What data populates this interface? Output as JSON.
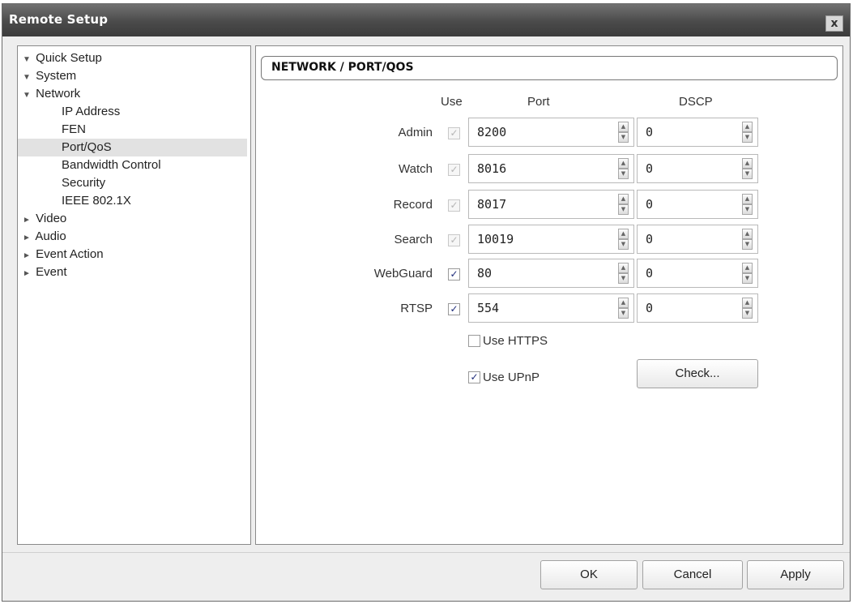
{
  "window": {
    "title": "Remote Setup",
    "close_label": "x"
  },
  "tree": {
    "items": [
      {
        "label": "Quick Setup",
        "expanded": true
      },
      {
        "label": "System",
        "expanded": true
      },
      {
        "label": "Network",
        "expanded": true
      },
      {
        "label": "IP Address"
      },
      {
        "label": "FEN"
      },
      {
        "label": "Port/QoS",
        "selected": true
      },
      {
        "label": "Bandwidth Control"
      },
      {
        "label": "Security"
      },
      {
        "label": "IEEE 802.1X"
      },
      {
        "label": "Video",
        "expanded": false
      },
      {
        "label": "Audio",
        "expanded": false
      },
      {
        "label": "Event Action",
        "expanded": false
      },
      {
        "label": "Event",
        "expanded": false
      }
    ],
    "arrow_expanded": "▼",
    "arrow_collapsed": "►"
  },
  "section": {
    "title": "NETWORK / PORT/QOS",
    "col_use": "Use",
    "col_port": "Port",
    "col_dscp": "DSCP",
    "rows": [
      {
        "label": "Admin",
        "use": true,
        "use_enabled": false,
        "port": "8200",
        "dscp": "0"
      },
      {
        "label": "Watch",
        "use": true,
        "use_enabled": false,
        "port": "8016",
        "dscp": "0"
      },
      {
        "label": "Record",
        "use": true,
        "use_enabled": false,
        "port": "8017",
        "dscp": "0"
      },
      {
        "label": "Search",
        "use": true,
        "use_enabled": false,
        "port": "10019",
        "dscp": "0"
      },
      {
        "label": "WebGuard",
        "use": true,
        "use_enabled": true,
        "port": "80",
        "dscp": "0"
      },
      {
        "label": "RTSP",
        "use": true,
        "use_enabled": true,
        "port": "554",
        "dscp": "0"
      }
    ]
  },
  "options": {
    "https_label": "Use HTTPS",
    "https_checked": false,
    "upnp_label": "Use UPnP",
    "upnp_checked": true,
    "check_button": "Check..."
  },
  "footer": {
    "ok": "OK",
    "cancel": "Cancel",
    "apply": "Apply"
  },
  "check_glyph": "✓"
}
